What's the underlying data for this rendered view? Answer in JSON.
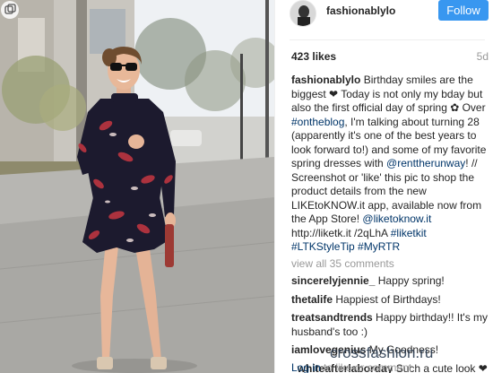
{
  "post": {
    "username": "fashionablylo",
    "follow_label": "Follow",
    "likes": "423 likes",
    "time_ago": "5d",
    "caption_parts": [
      {
        "type": "text",
        "text": "Birthday smiles are the biggest ❤ Today is not only my bday but also the first official day of spring ✿ Over "
      },
      {
        "type": "tag",
        "text": "#ontheblog"
      },
      {
        "type": "text",
        "text": ", I'm talking about turning 28 (apparently it's one of the best years to look forward to!) and some of my favorite spring dresses with "
      },
      {
        "type": "tag",
        "text": "@renttherunway"
      },
      {
        "type": "text",
        "text": "! // Screenshot or 'like' this pic to shop the product details from the new LIKEtoKNOW.it app, available now from the App Store! "
      },
      {
        "type": "tag",
        "text": "@liketoknow.it"
      },
      {
        "type": "text",
        "text": " http://liketk.it /2qLhA "
      },
      {
        "type": "tag",
        "text": "#liketkit"
      },
      {
        "type": "text",
        "text": " "
      },
      {
        "type": "tag",
        "text": "#LTKStyleTip"
      },
      {
        "type": "text",
        "text": " "
      },
      {
        "type": "tag",
        "text": "#MyRTR"
      }
    ],
    "view_all": "view all 35 comments"
  },
  "comments": [
    {
      "user": "sincerelyjennie_",
      "text": "Happy spring!"
    },
    {
      "user": "thetalife",
      "text": "Happiest of Birthdays!"
    },
    {
      "user": "treatsandtrends",
      "text": "Happy birthday!! It's my husband's too :)"
    },
    {
      "user": "iamlovegenius",
      "text": "My Goodness!"
    },
    {
      "user": "_whiteafterlaborday",
      "text": "Such a cute look ❤"
    }
  ],
  "footer": {
    "login_label": "Log in",
    "rest_text": " to like or comment."
  },
  "watermark": "crossfashion.ru",
  "colors": {
    "follow_bg": "#3897f0",
    "link": "#003569",
    "muted": "#999999",
    "dress": "#1c1a2e",
    "floral": "#b4343f"
  },
  "icons": {
    "carousel": "carousel-icon"
  }
}
